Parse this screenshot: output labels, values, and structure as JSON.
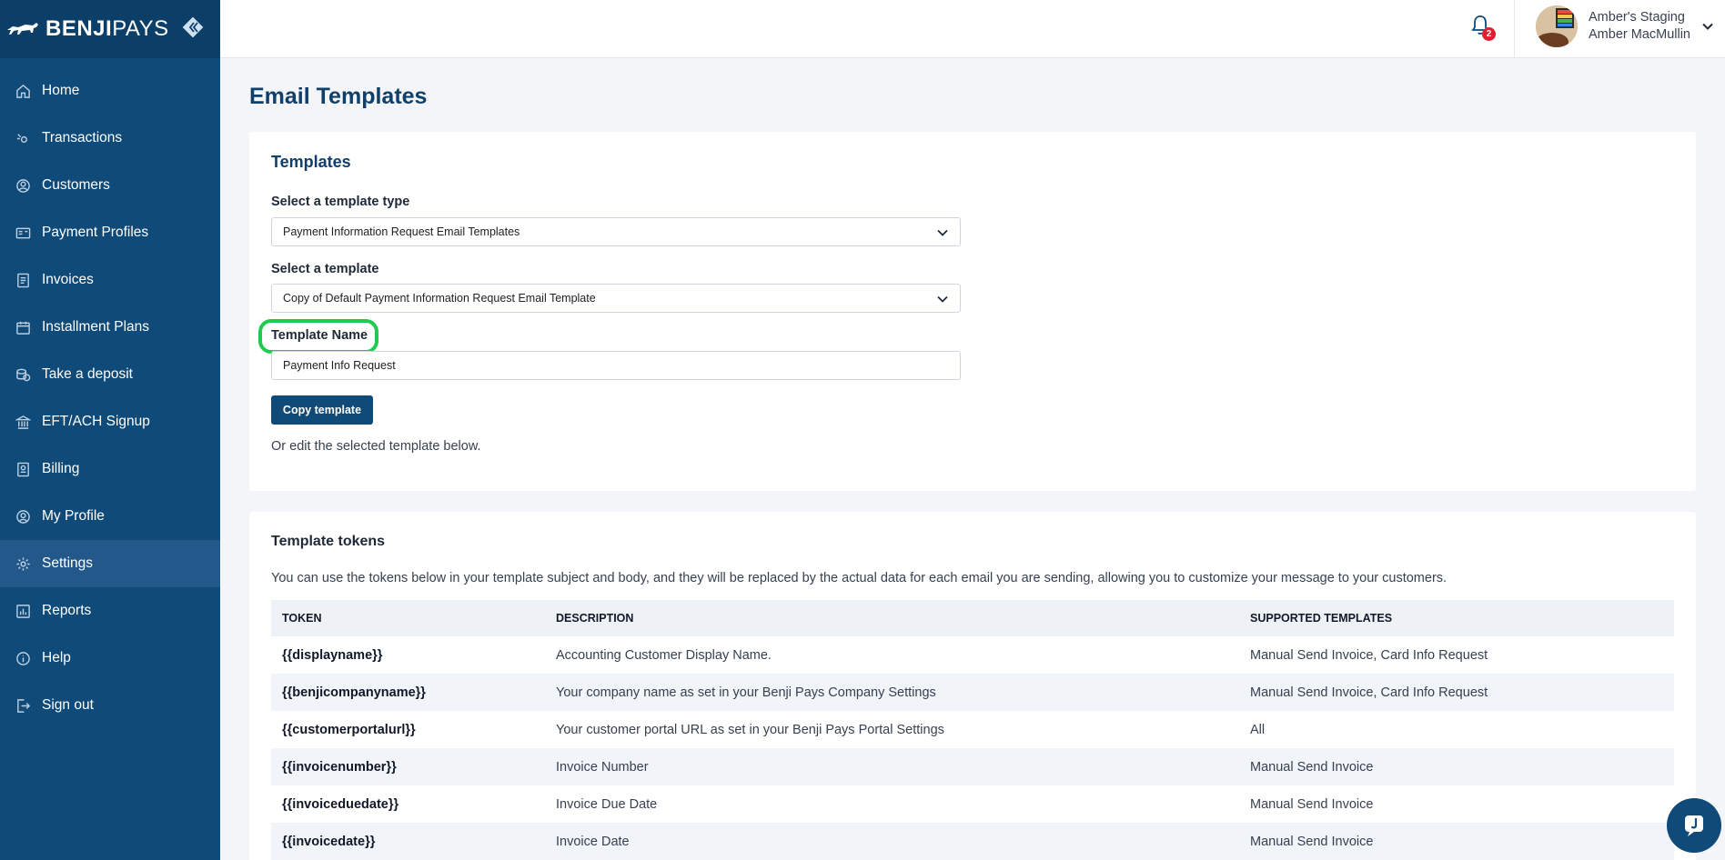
{
  "brand": {
    "name_bold": "BENJI",
    "name_light": "PAYS"
  },
  "sidebar": {
    "items": [
      {
        "label": "Home",
        "icon": "home-icon"
      },
      {
        "label": "Transactions",
        "icon": "transactions-icon"
      },
      {
        "label": "Customers",
        "icon": "customers-icon"
      },
      {
        "label": "Payment Profiles",
        "icon": "payment-profiles-icon"
      },
      {
        "label": "Invoices",
        "icon": "invoices-icon"
      },
      {
        "label": "Installment Plans",
        "icon": "calendar-icon"
      },
      {
        "label": "Take a deposit",
        "icon": "deposit-icon"
      },
      {
        "label": "EFT/ACH Signup",
        "icon": "bank-icon"
      },
      {
        "label": "Billing",
        "icon": "billing-icon"
      },
      {
        "label": "My Profile",
        "icon": "profile-icon"
      },
      {
        "label": "Settings",
        "icon": "gear-icon"
      },
      {
        "label": "Reports",
        "icon": "reports-icon"
      },
      {
        "label": "Help",
        "icon": "help-icon"
      },
      {
        "label": "Sign out",
        "icon": "sign-out-icon"
      }
    ],
    "active": "Settings"
  },
  "topbar": {
    "notification_count": "2",
    "company": "Amber's Staging",
    "user_name": "Amber MacMullin"
  },
  "page": {
    "title": "Email Templates"
  },
  "templates": {
    "title": "Templates",
    "type_label": "Select a template type",
    "type_value": "Payment Information Request Email Templates",
    "template_label": "Select a template",
    "template_value": "Copy of Default Payment Information Request Email Template",
    "name_label": "Template Name",
    "name_value": "Payment Info Request",
    "copy_button": "Copy template",
    "hint": "Or edit the selected template below."
  },
  "tokens": {
    "title": "Template tokens",
    "description": "You can use the tokens below in your template subject and body, and they will be replaced by the actual data for each email you are sending, allowing you to customize your message to your customers.",
    "columns": [
      "TOKEN",
      "DESCRIPTION",
      "SUPPORTED TEMPLATES"
    ],
    "rows": [
      {
        "token": "{{displayname}}",
        "description": "Accounting Customer Display Name.",
        "supported": "Manual Send Invoice, Card Info Request"
      },
      {
        "token": "{{benjicompanyname}}",
        "description": "Your company name as set in your Benji Pays Company Settings",
        "supported": "Manual Send Invoice, Card Info Request"
      },
      {
        "token": "{{customerportalurl}}",
        "description": "Your customer portal URL as set in your Benji Pays Portal Settings",
        "supported": "All"
      },
      {
        "token": "{{invoicenumber}}",
        "description": "Invoice Number",
        "supported": "Manual Send Invoice"
      },
      {
        "token": "{{invoiceduedate}}",
        "description": "Invoice Due Date",
        "supported": "Manual Send Invoice"
      },
      {
        "token": "{{invoicedate}}",
        "description": "Invoice Date",
        "supported": "Manual Send Invoice"
      }
    ]
  },
  "colors": {
    "sidebar": "#0f4a78",
    "accent": "#0f3f6b",
    "highlight": "#1ecb4f",
    "badge": "#e11d2e"
  }
}
